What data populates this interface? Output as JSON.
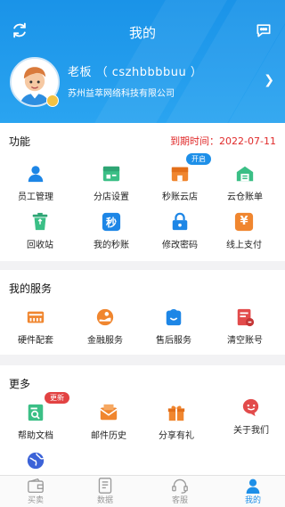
{
  "header": {
    "title": "我的",
    "left_icon": "refresh-icon",
    "right_icon": "chat-bubble-icon",
    "user_name": "老板 （ cszhbbbbuu ）",
    "company": "苏州益萃网络科技有限公司",
    "bg_color": "#1a93e8"
  },
  "functions": {
    "title": "功能",
    "expire_text": "到期时间：2022-07-11",
    "items": [
      {
        "label": "员工管理",
        "icon": "person-icon",
        "color": "#1d86e6"
      },
      {
        "label": "分店设置",
        "icon": "store-icon",
        "color": "#3bbf86"
      },
      {
        "label": "秒账云店",
        "icon": "cloud-store-icon",
        "color": "#f0862f",
        "tag": "开启"
      },
      {
        "label": "云仓账单",
        "icon": "warehouse-icon",
        "color": "#3bbf86"
      },
      {
        "label": "回收站",
        "icon": "trash-icon",
        "color": "#3bbf86"
      },
      {
        "label": "我的秒账",
        "icon": "miao-icon",
        "color": "#1d86e6",
        "glyph": "秒"
      },
      {
        "label": "修改密码",
        "icon": "lock-icon",
        "color": "#1d86e6"
      },
      {
        "label": "线上支付",
        "icon": "yuan-icon",
        "color": "#f0862f",
        "glyph": "¥"
      }
    ]
  },
  "services": {
    "title": "我的服务",
    "items": [
      {
        "label": "硬件配套",
        "icon": "hardware-icon",
        "color": "#f0862f"
      },
      {
        "label": "金融服务",
        "icon": "finance-icon",
        "color": "#f0862f"
      },
      {
        "label": "售后服务",
        "icon": "service-bag-icon",
        "color": "#1d86e6"
      },
      {
        "label": "清空账号",
        "icon": "clear-account-icon",
        "color": "#e24b4b"
      }
    ]
  },
  "more": {
    "title": "更多",
    "items": [
      {
        "label": "帮助文档",
        "icon": "help-doc-icon",
        "color": "#3bbf86",
        "tag": "更新"
      },
      {
        "label": "邮件历史",
        "icon": "mail-icon",
        "color": "#f0862f"
      },
      {
        "label": "分享有礼",
        "icon": "gift-icon",
        "color": "#f0862f"
      },
      {
        "label": "关于我们",
        "icon": "smile-chat-icon",
        "color": "#e24b4b"
      }
    ],
    "extra_icon": "globe-icon"
  },
  "tabbar": {
    "items": [
      {
        "label": "买卖",
        "icon": "wallet-icon",
        "active": false
      },
      {
        "label": "数据",
        "icon": "document-icon",
        "active": false
      },
      {
        "label": "客服",
        "icon": "headset-icon",
        "active": false
      },
      {
        "label": "我的",
        "icon": "user-icon",
        "active": true
      }
    ],
    "active_color": "#1d8fe8"
  }
}
